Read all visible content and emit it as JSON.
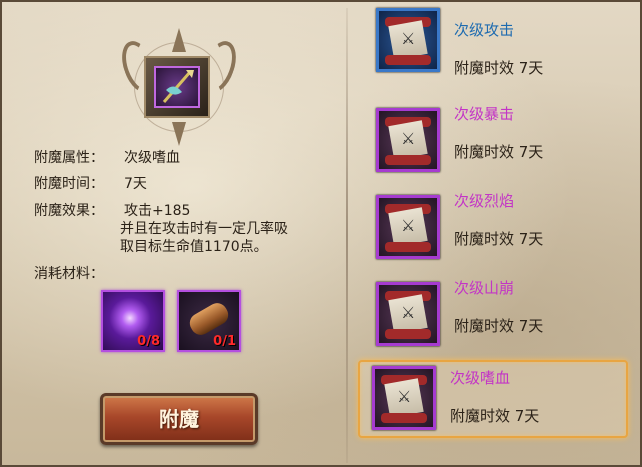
{
  "details": {
    "attr_label": "附魔属性：",
    "attr_value": "次级嗜血",
    "time_label": "附魔时间：",
    "time_value": "7天",
    "effect_label": "附魔效果：",
    "effect_line1": "攻击+185",
    "effect_line2": "并且在攻击时有一定几率吸",
    "effect_line3": "取目标生命值1170点。",
    "materials_label": "消耗材料："
  },
  "materials": [
    {
      "name": "purple-orb",
      "count": "0/8"
    },
    {
      "name": "scroll-roll",
      "count": "0/1"
    }
  ],
  "enchant_button": "附魔",
  "enchant_list": [
    {
      "name": "次级攻击",
      "duration": "附魔时效 7天",
      "color": "#1e6bb0",
      "selected": false
    },
    {
      "name": "次级暴击",
      "duration": "附魔时效 7天",
      "color": "#c335c6",
      "selected": false
    },
    {
      "name": "次级烈焰",
      "duration": "附魔时效 7天",
      "color": "#c335c6",
      "selected": false
    },
    {
      "name": "次级山崩",
      "duration": "附魔时效 7天",
      "color": "#c335c6",
      "selected": false
    },
    {
      "name": "次级嗜血",
      "duration": "附魔时效 7天",
      "color": "#c335c6",
      "selected": true
    }
  ]
}
